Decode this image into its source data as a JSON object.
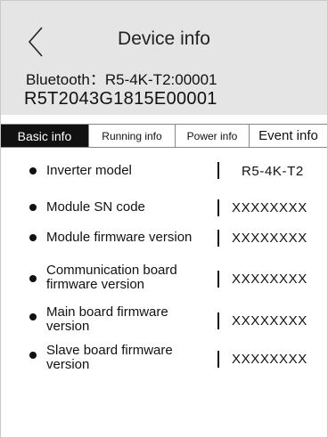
{
  "header": {
    "title": "Device info",
    "bluetooth": "Bluetooth：R5-4K-T2:00001",
    "serial": "R5T2043G1815E00001"
  },
  "tabs": [
    {
      "label": "Basic info",
      "active": true
    },
    {
      "label": "Running info",
      "active": false
    },
    {
      "label": "Power info",
      "active": false
    },
    {
      "label": "Event info",
      "active": false
    }
  ],
  "rows": [
    {
      "label": "Inverter model",
      "value": "R5-4K-T2"
    },
    {
      "label": "Module SN code",
      "value": "XXXXXXXX"
    },
    {
      "label": "Module firmware version",
      "value": "XXXXXXXX"
    },
    {
      "label": "Communication board firmware version",
      "value": "XXXXXXXX"
    },
    {
      "label": "Main board firmware version",
      "value": "XXXXXXXX"
    },
    {
      "label": "Slave board firmware version",
      "value": "XXXXXXXX"
    }
  ],
  "icons": {
    "back": "chevron-left-icon"
  }
}
